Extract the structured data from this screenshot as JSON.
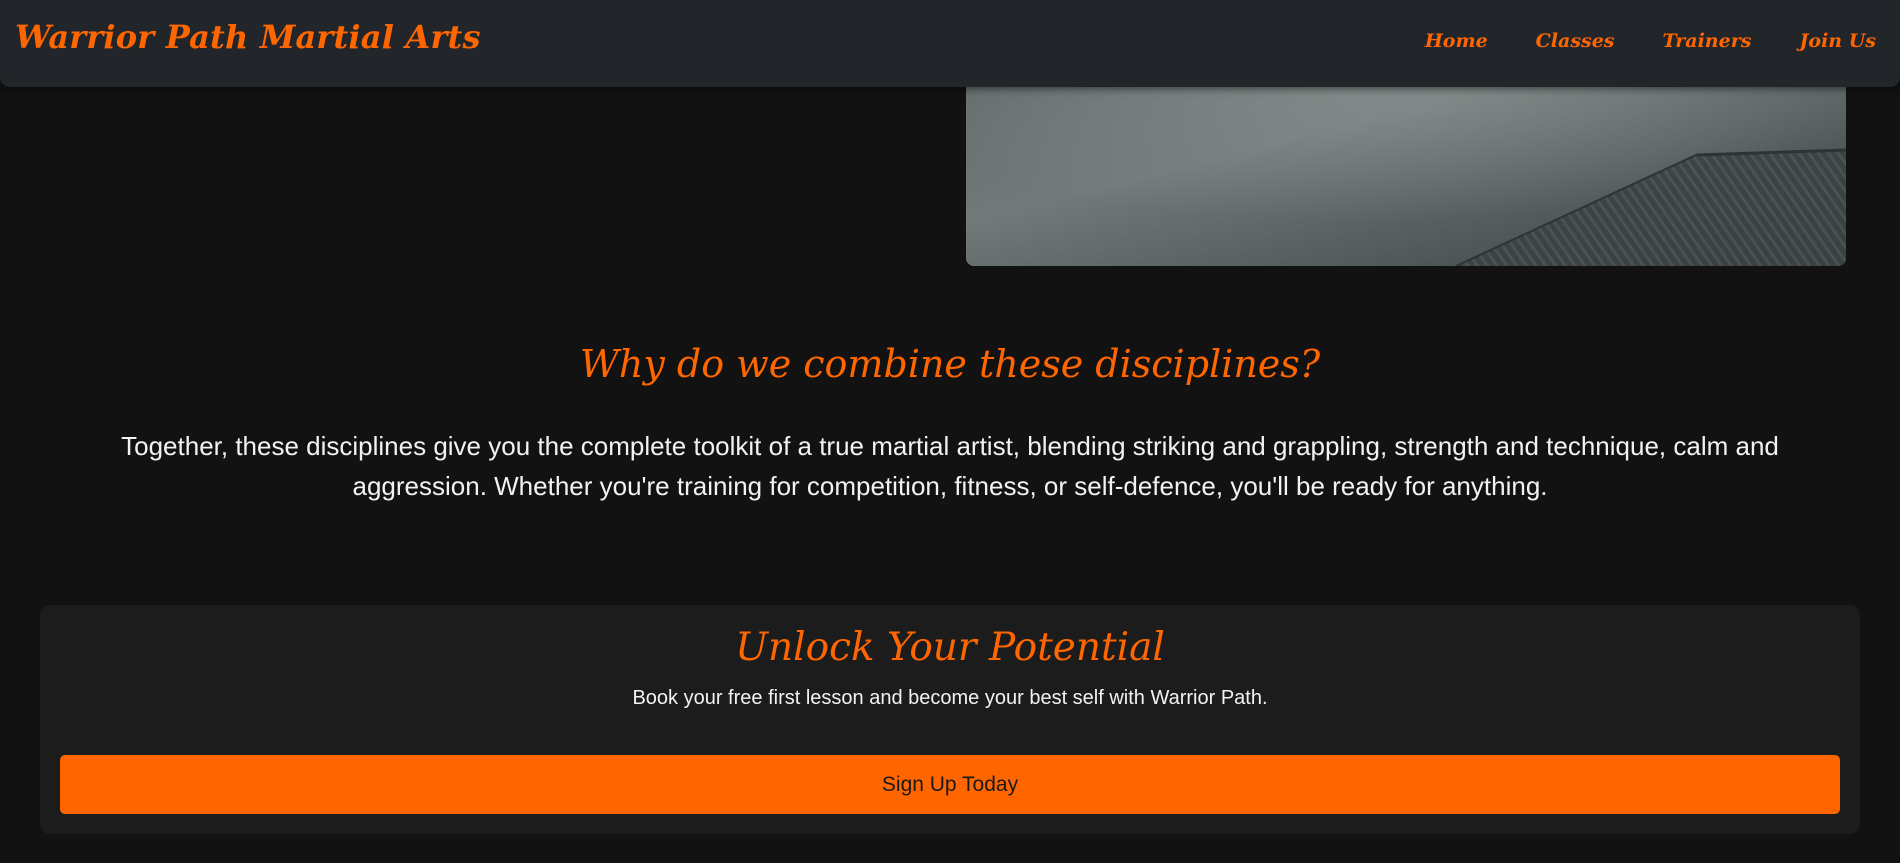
{
  "navbar": {
    "brand": "Warrior Path Martial Arts",
    "links": [
      {
        "label": "Home"
      },
      {
        "label": "Classes"
      },
      {
        "label": "Trainers"
      },
      {
        "label": "Join Us"
      }
    ]
  },
  "why": {
    "heading": "Why do we combine these disciplines?",
    "text": "Together, these disciplines give you the complete toolkit of a true martial artist, blending striking and grappling, strength and technique, calm and aggression. Whether you're training for competition, fitness, or self-defence, you'll be ready for anything."
  },
  "cta": {
    "heading": "Unlock Your Potential",
    "text": "Book your free first lesson and become your best self with Warrior Path.",
    "button_label": "Sign Up Today"
  },
  "colors": {
    "accent": "#ff6600",
    "background": "#121212",
    "navbar": "#22252a",
    "card": "#1c1c1c",
    "text": "#f2f2f2"
  },
  "icons": {
    "hero": "dojo-mat-photo"
  }
}
